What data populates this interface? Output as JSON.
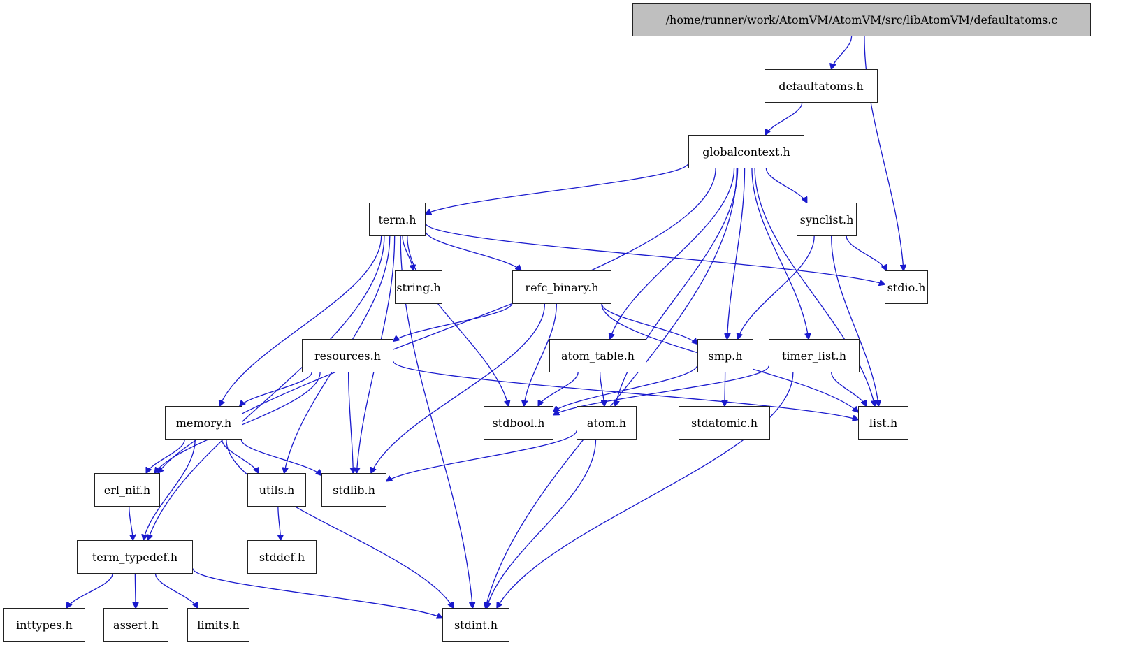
{
  "graph": {
    "title": "/home/runner/work/AtomVM/AtomVM/src/libAtomVM/defaultatoms.c",
    "colors": {
      "edge": "#1a1acd",
      "root_fill": "#bfbfbf",
      "node_fill": "#ffffff",
      "border": "#222222"
    },
    "nodes": [
      {
        "id": "defaultatoms_c",
        "label": "/home/runner/work/AtomVM/AtomVM/src/libAtomVM/defaultatoms.c",
        "root": true
      },
      {
        "id": "defaultatoms_h",
        "label": "defaultatoms.h"
      },
      {
        "id": "globalcontext_h",
        "label": "globalcontext.h"
      },
      {
        "id": "term_h",
        "label": "term.h"
      },
      {
        "id": "synclist_h",
        "label": "synclist.h"
      },
      {
        "id": "string_h",
        "label": "string.h"
      },
      {
        "id": "refc_binary_h",
        "label": "refc_binary.h"
      },
      {
        "id": "stdio_h",
        "label": "stdio.h"
      },
      {
        "id": "resources_h",
        "label": "resources.h"
      },
      {
        "id": "atom_table_h",
        "label": "atom_table.h"
      },
      {
        "id": "smp_h",
        "label": "smp.h"
      },
      {
        "id": "timer_list_h",
        "label": "timer_list.h"
      },
      {
        "id": "memory_h",
        "label": "memory.h"
      },
      {
        "id": "stdbool_h",
        "label": "stdbool.h"
      },
      {
        "id": "atom_h",
        "label": "atom.h"
      },
      {
        "id": "stdatomic_h",
        "label": "stdatomic.h"
      },
      {
        "id": "list_h",
        "label": "list.h"
      },
      {
        "id": "erl_nif_h",
        "label": "erl_nif.h"
      },
      {
        "id": "utils_h",
        "label": "utils.h"
      },
      {
        "id": "stdlib_h",
        "label": "stdlib.h"
      },
      {
        "id": "term_typedef_h",
        "label": "term_typedef.h"
      },
      {
        "id": "stddef_h",
        "label": "stddef.h"
      },
      {
        "id": "inttypes_h",
        "label": "inttypes.h"
      },
      {
        "id": "assert_h",
        "label": "assert.h"
      },
      {
        "id": "limits_h",
        "label": "limits.h"
      },
      {
        "id": "stdint_h",
        "label": "stdint.h"
      }
    ],
    "edges": [
      [
        "defaultatoms_c",
        "defaultatoms_h"
      ],
      [
        "defaultatoms_c",
        "stdio_h"
      ],
      [
        "defaultatoms_h",
        "globalcontext_h"
      ],
      [
        "globalcontext_h",
        "term_h"
      ],
      [
        "globalcontext_h",
        "erl_nif_h"
      ],
      [
        "globalcontext_h",
        "synclist_h"
      ],
      [
        "globalcontext_h",
        "atom_table_h"
      ],
      [
        "globalcontext_h",
        "atom_h"
      ],
      [
        "globalcontext_h",
        "smp_h"
      ],
      [
        "globalcontext_h",
        "timer_list_h"
      ],
      [
        "globalcontext_h",
        "list_h"
      ],
      [
        "globalcontext_h",
        "stdint_h"
      ],
      [
        "term_h",
        "string_h"
      ],
      [
        "term_h",
        "refc_binary_h"
      ],
      [
        "term_h",
        "stdio_h"
      ],
      [
        "term_h",
        "memory_h"
      ],
      [
        "term_h",
        "term_typedef_h"
      ],
      [
        "term_h",
        "utils_h"
      ],
      [
        "term_h",
        "stdlib_h"
      ],
      [
        "term_h",
        "stdbool_h"
      ],
      [
        "term_h",
        "stdint_h"
      ],
      [
        "synclist_h",
        "stdio_h"
      ],
      [
        "synclist_h",
        "smp_h"
      ],
      [
        "synclist_h",
        "list_h"
      ],
      [
        "refc_binary_h",
        "resources_h"
      ],
      [
        "refc_binary_h",
        "smp_h"
      ],
      [
        "refc_binary_h",
        "stdbool_h"
      ],
      [
        "refc_binary_h",
        "stdlib_h"
      ],
      [
        "refc_binary_h",
        "list_h"
      ],
      [
        "resources_h",
        "memory_h"
      ],
      [
        "resources_h",
        "erl_nif_h"
      ],
      [
        "resources_h",
        "stdlib_h"
      ],
      [
        "resources_h",
        "list_h"
      ],
      [
        "atom_table_h",
        "stdbool_h"
      ],
      [
        "atom_table_h",
        "atom_h"
      ],
      [
        "smp_h",
        "stdbool_h"
      ],
      [
        "smp_h",
        "stdatomic_h"
      ],
      [
        "timer_list_h",
        "stdbool_h"
      ],
      [
        "timer_list_h",
        "list_h"
      ],
      [
        "timer_list_h",
        "stdint_h"
      ],
      [
        "atom_h",
        "stdlib_h"
      ],
      [
        "atom_h",
        "stdint_h"
      ],
      [
        "memory_h",
        "erl_nif_h"
      ],
      [
        "memory_h",
        "utils_h"
      ],
      [
        "memory_h",
        "stdlib_h"
      ],
      [
        "memory_h",
        "term_typedef_h"
      ],
      [
        "memory_h",
        "stdint_h"
      ],
      [
        "erl_nif_h",
        "term_typedef_h"
      ],
      [
        "utils_h",
        "stddef_h"
      ],
      [
        "term_typedef_h",
        "inttypes_h"
      ],
      [
        "term_typedef_h",
        "assert_h"
      ],
      [
        "term_typedef_h",
        "limits_h"
      ],
      [
        "term_typedef_h",
        "stdint_h"
      ]
    ]
  }
}
